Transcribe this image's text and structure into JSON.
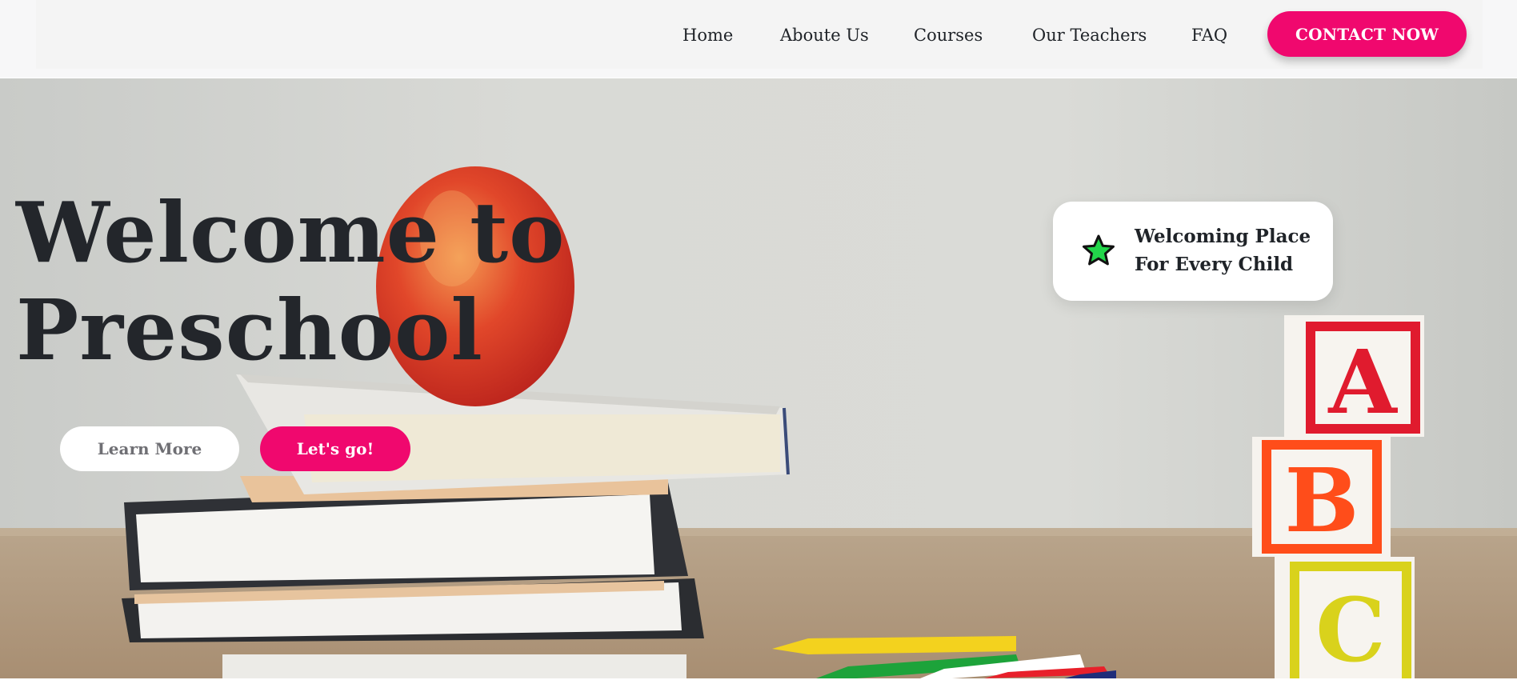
{
  "nav": {
    "links": [
      {
        "label": "Home"
      },
      {
        "label": "Aboute Us"
      },
      {
        "label": "Courses"
      },
      {
        "label": "Our Teachers"
      },
      {
        "label": "FAQ"
      }
    ],
    "contact_label": "CONTACT NOW"
  },
  "hero": {
    "title_line1": "Welcome to",
    "title_line2": "Preschool",
    "learn_more_label": "Learn More",
    "go_label": "Let's go!",
    "card": {
      "line1": "Welcoming Place",
      "line2": "For Every Child",
      "icon": "star-icon"
    },
    "blocks": [
      "A",
      "B",
      "C"
    ]
  },
  "colors": {
    "accent": "#f0086e",
    "star": "#22d64a",
    "title": "#23262b"
  }
}
